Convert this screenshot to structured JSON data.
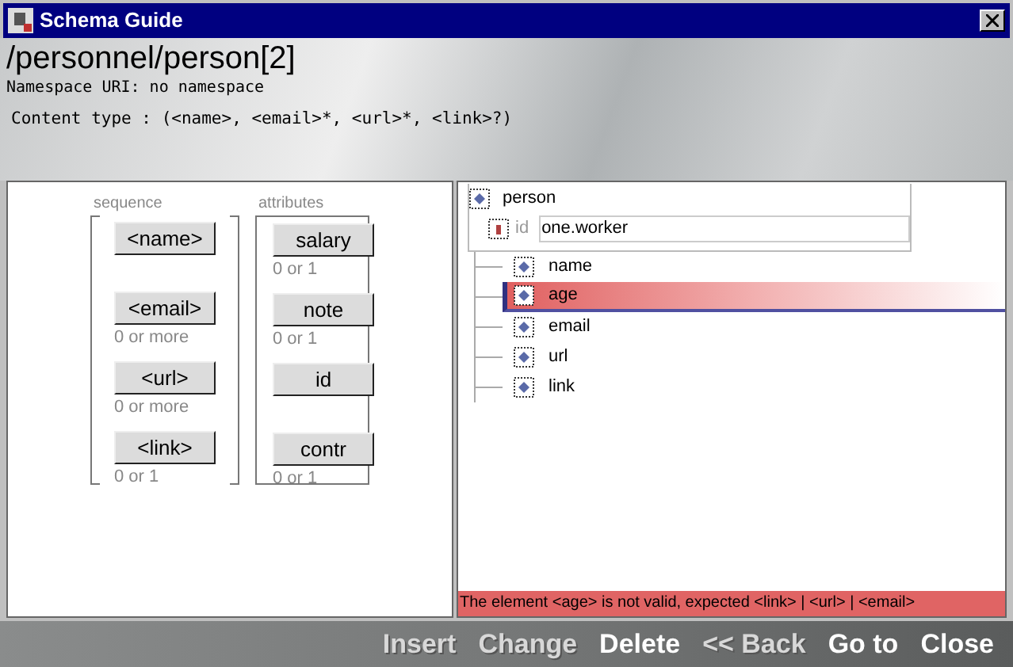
{
  "window": {
    "title": "Schema Guide"
  },
  "header": {
    "path": "/personnel/person[2]",
    "namespace": "Namespace URI: no namespace",
    "content_type": "Content type : (<name>, <email>*, <url>*, <link>?)"
  },
  "sequence": {
    "label": "sequence",
    "items": [
      {
        "label": "<name>"
      },
      {
        "label": "<email>",
        "note": "0 or more"
      },
      {
        "label": "<url>",
        "note": "0 or more"
      },
      {
        "label": "<link>",
        "note": "0 or 1"
      }
    ]
  },
  "attributes": {
    "label": "attributes",
    "items": [
      {
        "label": "salary",
        "note": "0 or 1"
      },
      {
        "label": "note",
        "note": "0 or 1"
      },
      {
        "label": "id"
      },
      {
        "label": "contr",
        "note": "0 or 1"
      }
    ]
  },
  "tree": {
    "root": "person",
    "attribute": {
      "name": "id",
      "value": "one.worker"
    },
    "children": [
      {
        "label": "name",
        "selected": false
      },
      {
        "label": "age",
        "selected": true
      },
      {
        "label": "email",
        "selected": false
      },
      {
        "label": "url",
        "selected": false
      },
      {
        "label": "link",
        "selected": false
      }
    ]
  },
  "error": "The element <age> is not valid, expected <link> | <url> | <email>",
  "buttons": [
    {
      "label": "Insert",
      "disabled": true
    },
    {
      "label": "Change",
      "disabled": true
    },
    {
      "label": "Delete",
      "disabled": false
    },
    {
      "label": "<< Back",
      "disabled": true
    },
    {
      "label": "Go to",
      "disabled": false
    },
    {
      "label": "Close",
      "disabled": false
    }
  ]
}
